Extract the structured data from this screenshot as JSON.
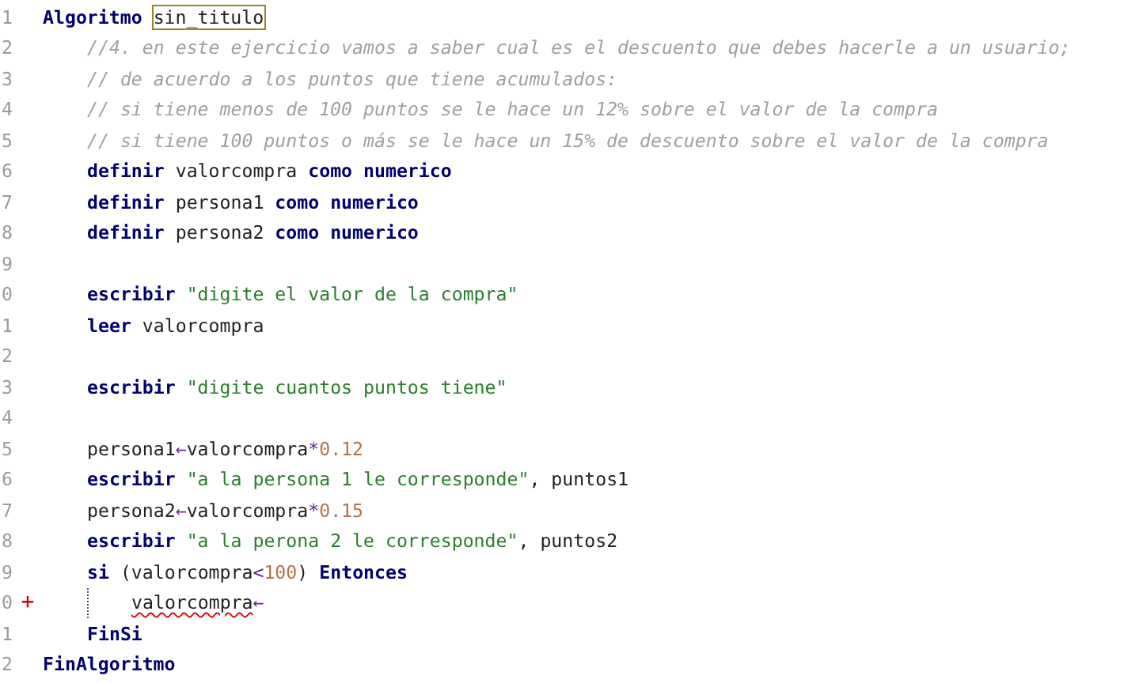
{
  "editor": {
    "lines": [
      {
        "number": "1",
        "tokens": [
          {
            "kind": "keyword",
            "text": "Algoritmo "
          },
          {
            "kind": "ident",
            "text": "sin_titulo",
            "highlighted": true
          }
        ],
        "children": [
          {
            "number": "2",
            "tokens": [
              {
                "kind": "comment",
                "text": "//4. en este ejercicio vamos a saber cual es el descuento que debes hacerle a un usuario;"
              }
            ]
          },
          {
            "number": "3",
            "tokens": [
              {
                "kind": "comment",
                "text": "// de acuerdo a los puntos que tiene acumulados:"
              }
            ]
          },
          {
            "number": "4",
            "tokens": [
              {
                "kind": "comment",
                "text": "// si tiene menos de 100 puntos se le hace un 12% sobre el valor de la compra"
              }
            ]
          },
          {
            "number": "5",
            "tokens": [
              {
                "kind": "comment",
                "text": "// si tiene 100 puntos o más se le hace un 15% de descuento sobre el valor de la compra"
              }
            ]
          },
          {
            "number": "6",
            "tokens": [
              {
                "kind": "keyword",
                "text": "definir "
              },
              {
                "kind": "ident",
                "text": "valorcompra "
              },
              {
                "kind": "keyword",
                "text": "como numerico"
              }
            ]
          },
          {
            "number": "7",
            "tokens": [
              {
                "kind": "keyword",
                "text": "definir "
              },
              {
                "kind": "ident",
                "text": "persona1 "
              },
              {
                "kind": "keyword",
                "text": "como numerico"
              }
            ]
          },
          {
            "number": "8",
            "tokens": [
              {
                "kind": "keyword",
                "text": "definir "
              },
              {
                "kind": "ident",
                "text": "persona2 "
              },
              {
                "kind": "keyword",
                "text": "como numerico"
              }
            ]
          },
          {
            "number": "9"
          },
          {
            "number": "0",
            "tokens": [
              {
                "kind": "keyword",
                "text": "escribir "
              },
              {
                "kind": "string",
                "text": "\"digite el valor de la compra\""
              }
            ]
          },
          {
            "number": "1",
            "tokens": [
              {
                "kind": "keyword",
                "text": "leer "
              },
              {
                "kind": "ident",
                "text": "valorcompra"
              }
            ]
          },
          {
            "number": "2"
          },
          {
            "number": "3",
            "tokens": [
              {
                "kind": "keyword",
                "text": "escribir "
              },
              {
                "kind": "string",
                "text": "\"digite cuantos puntos tiene\""
              }
            ]
          },
          {
            "number": "4"
          },
          {
            "number": "5",
            "tokens": [
              {
                "kind": "ident",
                "text": "persona1"
              },
              {
                "kind": "operator",
                "text": "←"
              },
              {
                "kind": "ident",
                "text": "valorcompra"
              },
              {
                "kind": "operator",
                "text": "*"
              },
              {
                "kind": "number",
                "text": "0.12"
              }
            ]
          },
          {
            "number": "6",
            "tokens": [
              {
                "kind": "keyword",
                "text": "escribir "
              },
              {
                "kind": "string",
                "text": "\"a la persona 1 le corresponde\""
              },
              {
                "kind": "ident",
                "text": ", puntos1"
              }
            ]
          },
          {
            "number": "7",
            "tokens": [
              {
                "kind": "ident",
                "text": "persona2"
              },
              {
                "kind": "operator",
                "text": "←"
              },
              {
                "kind": "ident",
                "text": "valorcompra"
              },
              {
                "kind": "operator",
                "text": "*"
              },
              {
                "kind": "number",
                "text": "0.15"
              }
            ]
          },
          {
            "number": "8",
            "tokens": [
              {
                "kind": "keyword",
                "text": "escribir "
              },
              {
                "kind": "string",
                "text": "\"a la perona 2 le corresponde\""
              },
              {
                "kind": "ident",
                "text": ", puntos2"
              }
            ]
          },
          {
            "number": "9",
            "tokens": [
              {
                "kind": "keyword",
                "text": "si "
              },
              {
                "kind": "ident",
                "text": "(valorcompra"
              },
              {
                "kind": "operator",
                "text": "<"
              },
              {
                "kind": "number",
                "text": "100"
              },
              {
                "kind": "ident",
                "text": ") "
              },
              {
                "kind": "keyword",
                "text": "Entonces"
              }
            ],
            "children": [
              {
                "number": "0",
                "marker": "+",
                "tokens": [
                  {
                    "kind": "ident",
                    "text": "valorcompra",
                    "error": true
                  },
                  {
                    "kind": "operator",
                    "text": "←"
                  }
                ]
              }
            ]
          },
          {
            "number": "1",
            "tokens": [
              {
                "kind": "keyword",
                "text": "FinSi"
              }
            ]
          }
        ]
      },
      {
        "number": "2",
        "tokens": [
          {
            "kind": "keyword",
            "text": "FinAlgoritmo"
          }
        ]
      }
    ]
  }
}
